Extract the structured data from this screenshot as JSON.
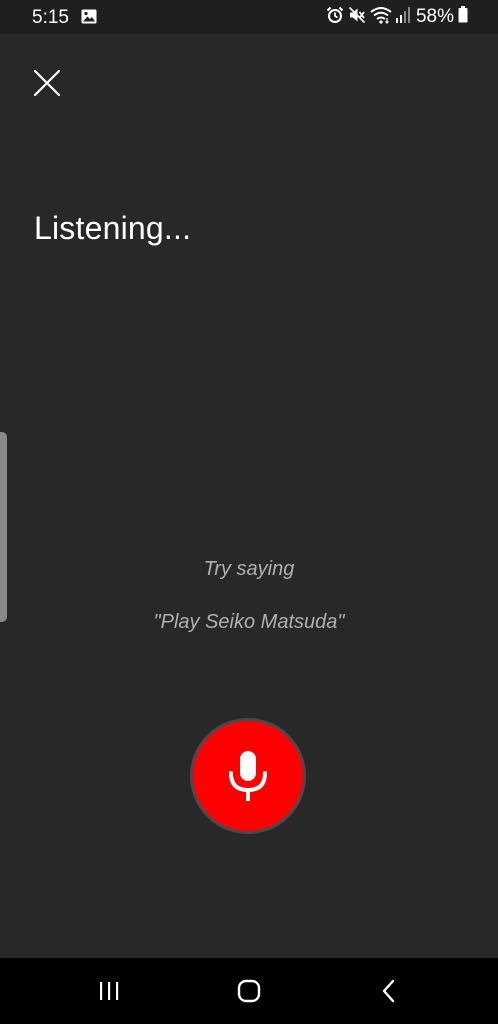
{
  "status_bar": {
    "time": "5:15",
    "battery_percent": "58%",
    "icons": [
      "gallery-icon",
      "alarm-icon",
      "mute-icon",
      "wifi-icon",
      "signal-icon",
      "battery-icon"
    ]
  },
  "header": {
    "close_icon": "close-icon"
  },
  "main": {
    "title": "Listening...",
    "hint_title": "Try saying",
    "hint_example": "\"Play Seiko Matsuda\""
  },
  "mic": {
    "icon": "microphone-icon",
    "color": "#ff0000"
  },
  "nav_bar": {
    "buttons": [
      "recent-apps-icon",
      "home-icon",
      "back-icon"
    ]
  },
  "colors": {
    "background": "#282828",
    "status_bar": "#1f1f1f",
    "nav_bar": "#000000",
    "text_primary": "#ffffff",
    "text_hint": "#b0b0b0",
    "accent": "#ff0000"
  }
}
